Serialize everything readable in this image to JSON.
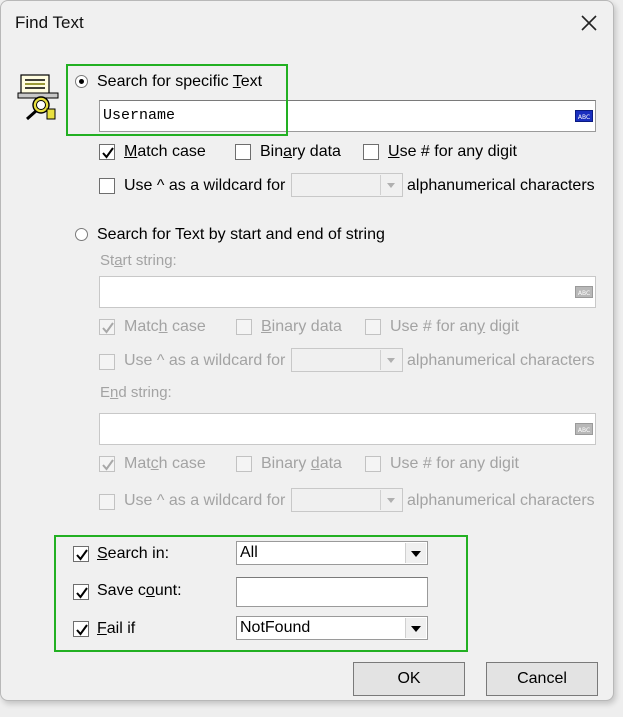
{
  "window": {
    "title": "Find Text",
    "close_icon": "close-icon"
  },
  "colors": {
    "highlight": "#22b022",
    "disabled_text": "#a3a3a3",
    "accent_abc": "#1a2fbf"
  },
  "specific": {
    "radio_label_pre": "Search for specific ",
    "radio_label_key": "T",
    "radio_label_post": "ext",
    "selected": true,
    "value": "Username",
    "options": {
      "match_case_pre": "",
      "match_case_key": "M",
      "match_case_post": "atch case",
      "match_case_checked": true,
      "binary_pre": "Bin",
      "binary_key": "a",
      "binary_post": "ry data",
      "binary_checked": false,
      "digit_pre": "",
      "digit_key": "U",
      "digit_post": "se # for any digit",
      "digit_checked": false,
      "wildcard_label": "Use ^ as a wildcard for",
      "wildcard_checked": false,
      "wildcard_suffix": "alphanumerical characters"
    }
  },
  "startend": {
    "radio_label": "Search for Text by start and end of string",
    "selected": false,
    "start_label_pre": "St",
    "start_label_key": "a",
    "start_label_post": "rt string:",
    "start_value": "",
    "start_options": {
      "match_case_pre": "Matc",
      "match_case_key": "h",
      "match_case_post": " case",
      "match_case_checked": true,
      "binary_pre": "",
      "binary_key": "B",
      "binary_post": "inary data",
      "digit_pre": "Use # for an",
      "digit_key": "y",
      "digit_post": " digit",
      "wildcard_label": "Use ^ as a wildcard for",
      "wildcard_suffix": "alphanumerical characters"
    },
    "end_label_pre": "E",
    "end_label_key": "n",
    "end_label_post": "d string:",
    "end_value": "",
    "end_options": {
      "match_case_pre": "Mat",
      "match_case_key": "c",
      "match_case_post": "h case",
      "match_case_checked": true,
      "binary_pre": "Binary ",
      "binary_key": "d",
      "binary_post": "ata",
      "digit_pre": "Use # for any digit",
      "digit_key": "",
      "digit_post": "",
      "wildcard_label": "Use ^ as a wildcard for",
      "wildcard_suffix": "alphanumerical characters"
    }
  },
  "bottom": {
    "search_in_pre": "",
    "search_in_key": "S",
    "search_in_post": "earch in:",
    "search_in_checked": true,
    "search_in_value": "All",
    "save_count_pre": "Save c",
    "save_count_key": "o",
    "save_count_post": "unt:",
    "save_count_checked": true,
    "save_count_value": "",
    "fail_if_pre": "",
    "fail_if_key": "F",
    "fail_if_post": "ail if",
    "fail_if_checked": true,
    "fail_if_value": "NotFound"
  },
  "buttons": {
    "ok": "OK",
    "cancel": "Cancel"
  }
}
